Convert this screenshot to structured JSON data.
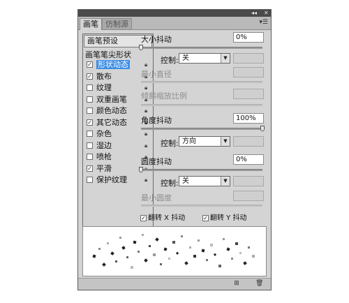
{
  "titlebar": {
    "collapse_icon": "collapse-icon",
    "close_icon": "close-icon"
  },
  "tabs": [
    {
      "label": "画笔",
      "active": true
    },
    {
      "label": "仿制源",
      "active": false
    }
  ],
  "panel_menu_icon": "panel-menu-icon",
  "left": {
    "preset_button": "画笔预设",
    "tip_shape_label": "画笔笔尖形状",
    "items": [
      {
        "label": "形状动态",
        "checked": true
      },
      {
        "label": "散布",
        "checked": true
      },
      {
        "label": "纹理",
        "checked": false
      },
      {
        "label": "双重画笔",
        "checked": false
      },
      {
        "label": "颜色动态",
        "checked": false
      },
      {
        "label": "其它动态",
        "checked": true
      },
      {
        "label": "杂色",
        "checked": false
      },
      {
        "label": "湿边",
        "checked": false
      },
      {
        "label": "喷枪",
        "checked": false
      },
      {
        "label": "平滑",
        "checked": true
      },
      {
        "label": "保护纹理",
        "checked": false
      }
    ]
  },
  "right": {
    "size_jitter": {
      "label": "大小抖动",
      "value": "0%",
      "level": 0
    },
    "control1": {
      "label": "控制:",
      "value": "关"
    },
    "min_diameter": {
      "label": "最小直径"
    },
    "tilt_scale": {
      "label": "倾斜缩放比例"
    },
    "angle_jitter": {
      "label": "角度抖动",
      "value": "100%",
      "level": 1.0
    },
    "control2": {
      "label": "控制:",
      "value": "方向"
    },
    "roundness_jitter": {
      "label": "圆度抖动",
      "value": "0%",
      "level": 0
    },
    "control3": {
      "label": "控制:",
      "value": "关"
    },
    "min_roundness": {
      "label": "最小圆度"
    },
    "flip_x": {
      "label": "翻转 X 抖动",
      "checked": true
    },
    "flip_y": {
      "label": "翻转 Y 抖动",
      "checked": true
    }
  },
  "bottom": {
    "new_icon": "new-brush-icon",
    "delete_icon": "trash-icon"
  },
  "colors": {
    "selection": "#3d8ee6",
    "panel": "#d4d4d4",
    "titlebar": "#4a4a4a"
  }
}
